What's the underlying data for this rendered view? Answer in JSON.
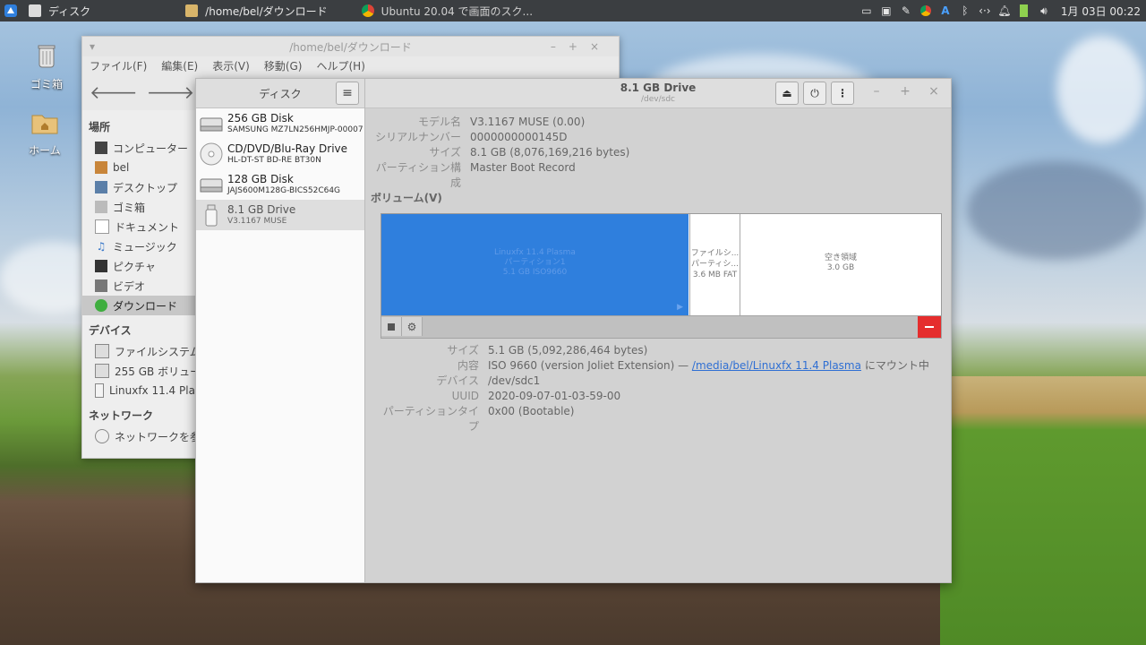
{
  "panel": {
    "tasks": [
      {
        "label": "ディスク"
      },
      {
        "label": "/home/bel/ダウンロード"
      },
      {
        "label": "Ubuntu 20.04 で画面のスク..."
      }
    ],
    "clock": "1月 03日 00:22",
    "tray_letter": "A"
  },
  "desktop_icons": [
    {
      "label": "ゴミ箱"
    },
    {
      "label": "ホーム"
    }
  ],
  "file_manager": {
    "title": "/home/bel/ダウンロード",
    "menu": [
      "ファイル(F)",
      "編集(E)",
      "表示(V)",
      "移動(G)",
      "ヘルプ(H)"
    ],
    "sections": {
      "places": "場所",
      "devices": "デバイス",
      "network": "ネットワーク"
    },
    "places": [
      "コンピューター",
      "bel",
      "デスクトップ",
      "ゴミ箱",
      "ドキュメント",
      "ミュージック",
      "ピクチャ",
      "ビデオ",
      "ダウンロード"
    ],
    "devices": [
      "ファイルシステム",
      "255 GB ボリューム",
      "Linuxfx 11.4 Plasma"
    ],
    "network": [
      "ネットワークを参照"
    ]
  },
  "disks": {
    "header": "ディスク",
    "drives": [
      {
        "name": "256 GB Disk",
        "model": "SAMSUNG MZ7LN256HMJP-00007"
      },
      {
        "name": "CD/DVD/Blu-Ray Drive",
        "model": "HL-DT-ST BD-RE BT30N"
      },
      {
        "name": "128 GB Disk",
        "model": "JAJS600M128G-BICS52C64G"
      },
      {
        "name": "8.1 GB Drive",
        "model": "V3.1167 MUSE"
      }
    ],
    "title": "8.1 GB Drive",
    "subtitle": "/dev/sdc",
    "info": [
      {
        "k": "モデル名",
        "v": "V3.1167 MUSE (0.00)"
      },
      {
        "k": "シリアルナンバー",
        "v": "0000000000145D"
      },
      {
        "k": "サイズ",
        "v": "8.1 GB (8,076,169,216 bytes)"
      },
      {
        "k": "パーティション構成",
        "v": "Master Boot Record"
      }
    ],
    "volumes_label": "ボリューム(V)",
    "segments": [
      {
        "l1": "Linuxfx 11.4 Plasma",
        "l2": "パーティション1",
        "l3": "5.1 GB ISO9660"
      },
      {
        "l1": "ファイルシ...",
        "l2": "パーティシ...",
        "l3": "3.6 MB FAT"
      },
      {
        "l1": "空き領域",
        "l2": "3.0 GB"
      }
    ],
    "partition": {
      "size_k": "サイズ",
      "size_v": "5.1 GB (5,092,286,464 bytes)",
      "content_k": "内容",
      "content_v": "ISO 9660 (version Joliet Extension) —",
      "content_link": "/media/bel/Linuxfx 11.4 Plasma",
      "content_suffix": "にマウント中",
      "device_k": "デバイス",
      "device_v": "/dev/sdc1",
      "uuid_k": "UUID",
      "uuid_v": "2020-09-07-01-03-59-00",
      "type_k": "パーティションタイプ",
      "type_v": "0x00 (Bootable)"
    }
  }
}
